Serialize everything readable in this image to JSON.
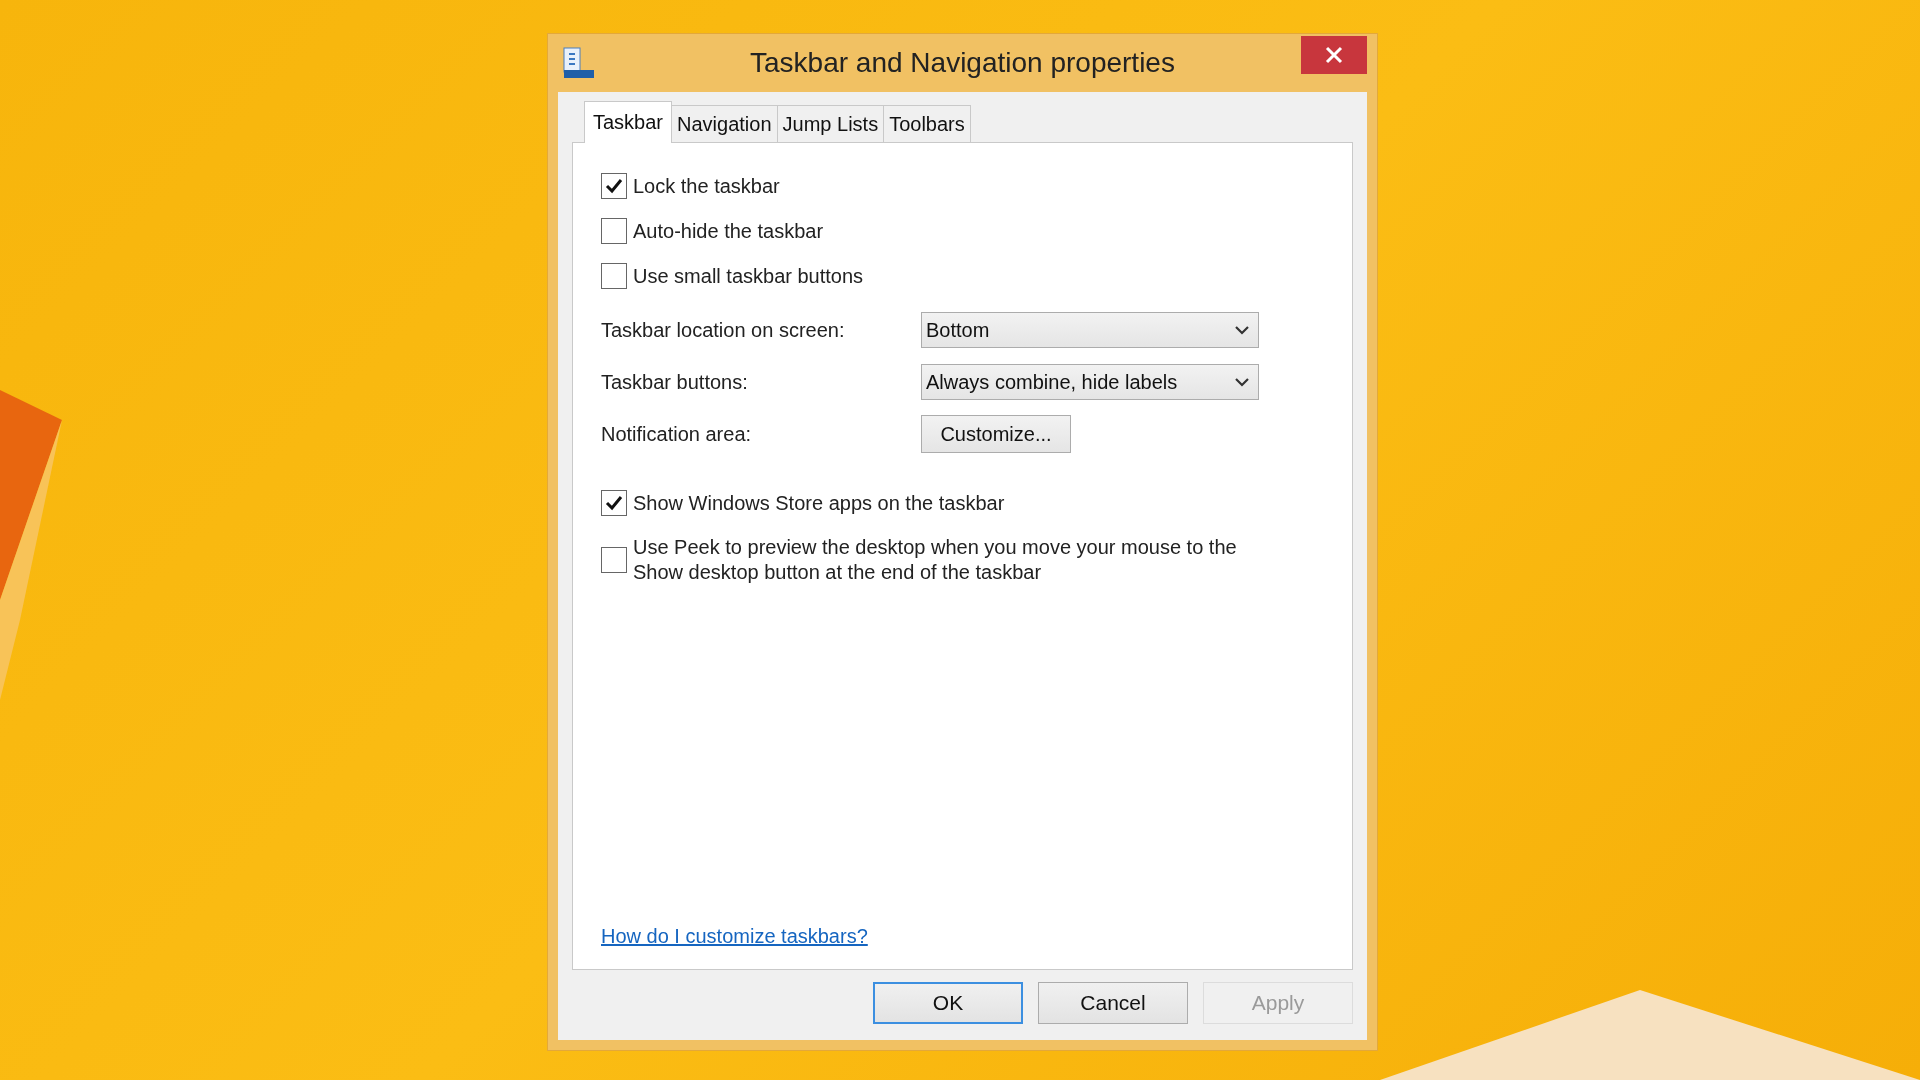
{
  "window": {
    "title": "Taskbar and Navigation properties"
  },
  "tabs": [
    {
      "label": "Taskbar",
      "selected": true
    },
    {
      "label": "Navigation",
      "selected": false
    },
    {
      "label": "Jump Lists",
      "selected": false
    },
    {
      "label": "Toolbars",
      "selected": false
    }
  ],
  "options": [
    {
      "kind": "checkbox",
      "label": "Lock the taskbar",
      "checked": true
    },
    {
      "kind": "checkbox",
      "label": "Auto-hide the taskbar",
      "checked": false
    },
    {
      "kind": "checkbox",
      "label": "Use small taskbar buttons",
      "checked": false
    },
    {
      "kind": "select",
      "label": "Taskbar location on screen:",
      "value": "Bottom"
    },
    {
      "kind": "select",
      "label": "Taskbar buttons:",
      "value": "Always combine, hide labels"
    },
    {
      "kind": "button",
      "label": "Notification area:",
      "button": "Customize..."
    },
    {
      "kind": "checkbox",
      "label": "Show Windows Store apps on the taskbar",
      "checked": true
    },
    {
      "kind": "checkbox",
      "label": "Use Peek to preview the desktop when you move your mouse to the Show desktop button at the end of the taskbar",
      "checked": false
    }
  ],
  "help_link": "How do I customize taskbars?",
  "buttons": [
    {
      "label": "OK",
      "default": true,
      "disabled": false
    },
    {
      "label": "Cancel",
      "default": false,
      "disabled": false
    },
    {
      "label": "Apply",
      "default": false,
      "disabled": true
    }
  ]
}
